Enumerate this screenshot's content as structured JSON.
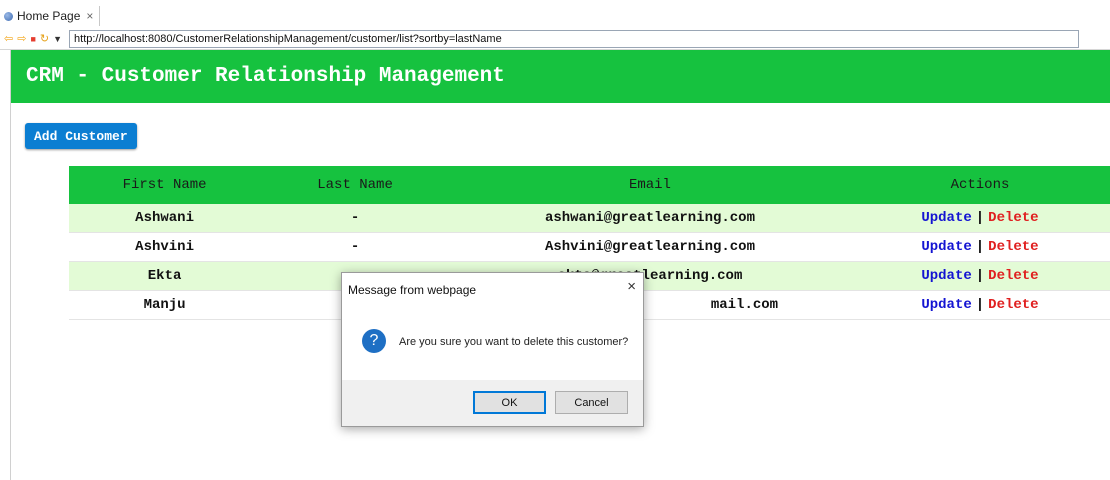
{
  "browser": {
    "tab_title": "Home Page",
    "tab_close": "×",
    "url": "http://localhost:8080/CustomerRelationshipManagement/customer/list?sortby=lastName"
  },
  "header": {
    "title": "CRM - Customer Relationship Management"
  },
  "add_button": {
    "label": "Add Customer"
  },
  "table": {
    "headers": [
      "First Name",
      "Last Name",
      "Email",
      "Actions"
    ],
    "rows": [
      {
        "first": "Ashwani",
        "last": "-",
        "email": "ashwani@greatlearning.com"
      },
      {
        "first": "Ashvini",
        "last": "-",
        "email": "Ashvini@greatlearning.com"
      },
      {
        "first": "Ekta",
        "last": "-",
        "email": "ekta@greatlearning.com"
      },
      {
        "first": "Manju",
        "last": "",
        "email": "mail.com"
      }
    ],
    "update_label": "Update",
    "delete_label": "Delete",
    "separator": "|"
  },
  "dialog": {
    "title": "Message from webpage",
    "close": "×",
    "icon": "question-icon",
    "icon_glyph": "?",
    "message": "Are you sure you want to delete this customer?",
    "ok_label": "OK",
    "cancel_label": "Cancel"
  },
  "colors": {
    "header_green": "#16c23f",
    "row_alt": "#e3fbd6",
    "button_blue": "#0b7ed2",
    "update_link": "#1414d2",
    "delete_link": "#e02020"
  }
}
